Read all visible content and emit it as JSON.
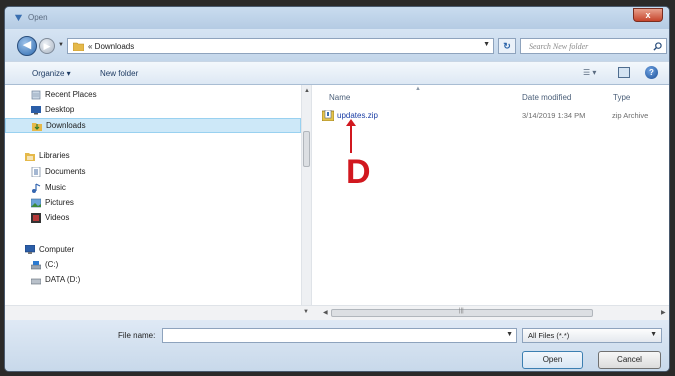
{
  "window": {
    "title": "Open",
    "close_label": "x"
  },
  "navbar": {
    "address_text": "« Downloads",
    "search_placeholder": "Search New folder"
  },
  "toolbar": {
    "organize_label": "Organize ▾",
    "new_folder_label": "New folder"
  },
  "sidebar": {
    "items": [
      {
        "label": "Recent Places",
        "icon": "recent-places-icon"
      },
      {
        "label": "Desktop",
        "icon": "desktop-icon"
      },
      {
        "label": "Downloads",
        "icon": "downloads-folder-icon",
        "selected": true
      },
      {
        "label": "Libraries",
        "icon": "libraries-icon"
      },
      {
        "label": "Documents",
        "icon": "documents-icon"
      },
      {
        "label": "Music",
        "icon": "music-icon"
      },
      {
        "label": "Pictures",
        "icon": "pictures-icon"
      },
      {
        "label": "Videos",
        "icon": "videos-icon"
      },
      {
        "label": "Computer",
        "icon": "computer-icon"
      },
      {
        "label": "(C:)",
        "icon": "drive-c-icon"
      },
      {
        "label": "DATA (D:)",
        "icon": "drive-d-icon"
      }
    ]
  },
  "filelist": {
    "columns": [
      "Name",
      "Date modified",
      "Type"
    ],
    "files": [
      {
        "name": "updates.zip",
        "date": "3/14/2019 1:34 PM",
        "type": "zip Archive"
      }
    ],
    "annotation": "D"
  },
  "bottom": {
    "filename_label": "File name:",
    "filename_value": "",
    "filter_value": "All Files (*.*)",
    "open_label": "Open",
    "cancel_label": "Cancel"
  },
  "colors": {
    "annotation": "#d1181f",
    "link": "#1c3fa5",
    "selection": "#cde8f8"
  }
}
